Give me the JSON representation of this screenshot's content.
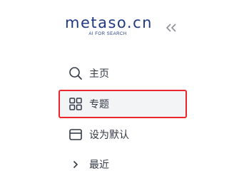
{
  "logo": {
    "name": "metaso.cn",
    "tagline": "AI FOR SEARCH"
  },
  "sidebar": {
    "collapse_icon": "double-chevron-left-icon",
    "items": [
      {
        "label": "主页",
        "icon": "search-icon",
        "selected": false
      },
      {
        "label": "专题",
        "icon": "grid-icon",
        "selected": true
      },
      {
        "label": "设为默认",
        "icon": "window-icon",
        "selected": false
      },
      {
        "label": "最近",
        "icon": "chevron-right-icon",
        "selected": false
      }
    ]
  },
  "colors": {
    "brand": "#1f3a82",
    "highlight_border": "#e8262b",
    "selected_bg": "#f3f4f6",
    "text": "#333a45"
  }
}
